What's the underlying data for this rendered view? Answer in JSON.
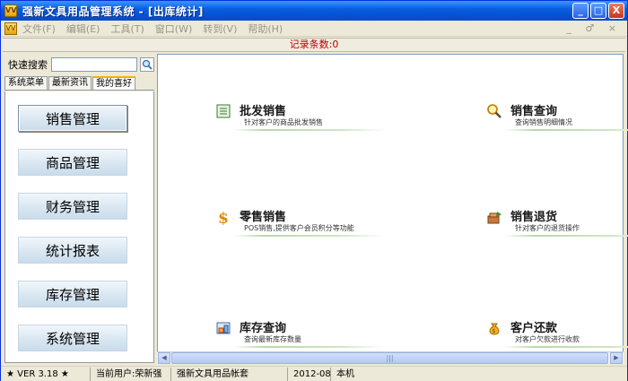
{
  "window": {
    "title": "强新文具用品管理系统 - [出库统计]",
    "app_icon_label": "VV",
    "buttons": [
      "_",
      "□",
      "X"
    ]
  },
  "menubar": {
    "items": [
      "文件(F)",
      "编辑(E)",
      "工具(T)",
      "窗口(W)",
      "转到(V)",
      "帮助(H)"
    ],
    "mdi_controls": "_ ♂ ×"
  },
  "record_bar": {
    "text": "记录条数:0"
  },
  "left": {
    "search_label": "快速搜索",
    "search_value": "",
    "tabs": [
      "系统菜单",
      "最新资讯",
      "我的喜好"
    ],
    "active_tab": "我的喜好",
    "nav": [
      "销售管理",
      "商品管理",
      "财务管理",
      "统计报表",
      "库存管理",
      "系统管理"
    ],
    "selected_nav": "销售管理"
  },
  "tiles": [
    {
      "title": "批发销售",
      "desc": "针对客户的商品批发销售",
      "icon": "ledger-icon"
    },
    {
      "title": "销售查询",
      "desc": "查询销售明细情况",
      "icon": "magnifier-icon"
    },
    {
      "title": "零售销售",
      "desc": "POS销售,提供客户会员积分等功能",
      "icon": "dollar-icon"
    },
    {
      "title": "销售退货",
      "desc": "针对客户的退货操作",
      "icon": "return-box-icon"
    },
    {
      "title": "库存查询",
      "desc": "查询最新库存数量",
      "icon": "inventory-icon"
    },
    {
      "title": "客户还款",
      "desc": "对客户欠款进行收款",
      "icon": "money-bag-icon"
    }
  ],
  "scrollbar": {
    "left_arrow": "◀",
    "right_arrow": "▶",
    "grip": "|||"
  },
  "statusbar": {
    "version": "VER 3.18",
    "user": "当前用户:荣新强",
    "account": "强新文具用品帐套",
    "date": "2012-08",
    "machine": "本机"
  },
  "colors": {
    "title_bar": "#0553d4",
    "record_text": "#c00000",
    "tile_underline": "#b8d9a8"
  }
}
